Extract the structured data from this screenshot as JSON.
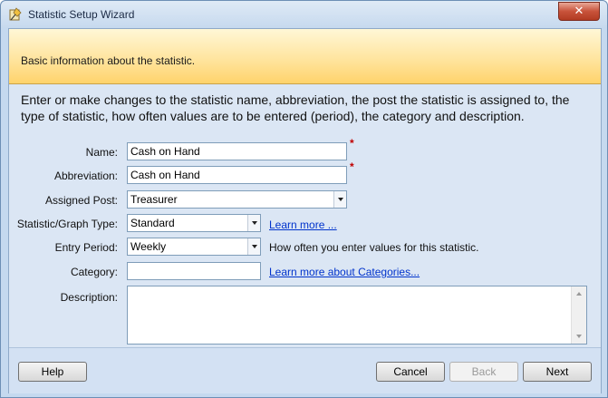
{
  "window": {
    "title": "Statistic Setup Wizard",
    "close_glyph": "✕"
  },
  "banner": {
    "text": "Basic information about the statistic."
  },
  "instructions": "Enter or make changes to the statistic name, abbreviation, the post the statistic is assigned to, the type of statistic, how often values are to be entered (period), the category and description.",
  "form": {
    "name": {
      "label": "Name:",
      "value": "Cash on Hand",
      "required_mark": "*"
    },
    "abbreviation": {
      "label": "Abbreviation:",
      "value": "Cash on Hand",
      "required_mark": "*"
    },
    "assigned_post": {
      "label": "Assigned Post:",
      "value": "Treasurer"
    },
    "graph_type": {
      "label": "Statistic/Graph Type:",
      "value": "Standard",
      "link": "Learn more ..."
    },
    "entry_period": {
      "label": "Entry Period:",
      "value": "Weekly",
      "hint": "How often you enter values for this statistic."
    },
    "category": {
      "label": "Category:",
      "value": "",
      "link": "Learn more about Categories..."
    },
    "description": {
      "label": "Description:",
      "value": ""
    }
  },
  "buttons": {
    "help": "Help",
    "cancel": "Cancel",
    "back": "Back",
    "next": "Next"
  },
  "colors": {
    "banner_accent": "#ffd36b",
    "link": "#0033cc",
    "required": "#c00000",
    "close_button": "#c8533b"
  }
}
